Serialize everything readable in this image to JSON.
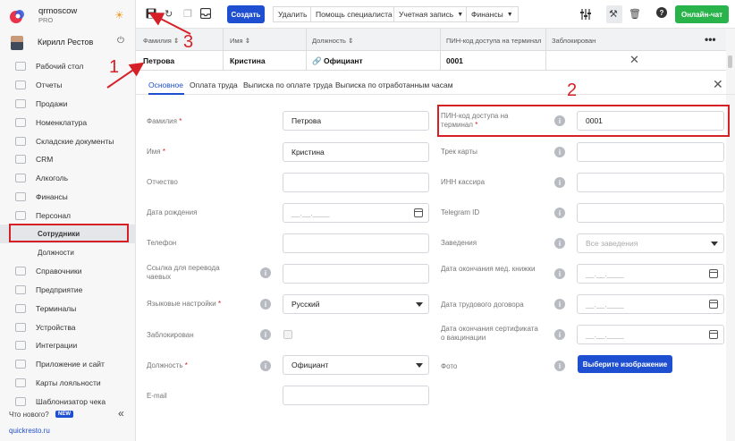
{
  "brand": {
    "name": "qrmoscow",
    "plan": "PRO"
  },
  "user": {
    "name": "Кирилл Рестов"
  },
  "sidebar": {
    "items": [
      {
        "label": "Рабочий стол"
      },
      {
        "label": "Отчеты"
      },
      {
        "label": "Продажи"
      },
      {
        "label": "Номенклатура"
      },
      {
        "label": "Складские документы"
      },
      {
        "label": "CRM"
      },
      {
        "label": "Алкоголь"
      },
      {
        "label": "Финансы"
      },
      {
        "label": "Персонал"
      }
    ],
    "sub_items": [
      {
        "label": "Сотрудники"
      },
      {
        "label": "Должности"
      }
    ],
    "items_after": [
      {
        "label": "Справочники"
      },
      {
        "label": "Предприятие"
      },
      {
        "label": "Терминалы"
      },
      {
        "label": "Устройства"
      },
      {
        "label": "Интеграции"
      },
      {
        "label": "Приложение и сайт"
      },
      {
        "label": "Карты лояльности"
      },
      {
        "label": "Шаблонизатор чека"
      }
    ],
    "whats_new": "Что нового?",
    "new_badge": "NEW",
    "site_link": "quickresto.ru"
  },
  "toolbar": {
    "create": "Создать",
    "delete": "Удалить",
    "help": "Помощь специалиста",
    "account": "Учетная запись",
    "finance": "Финансы",
    "online_chat": "Онлайн-чат"
  },
  "table": {
    "headers": [
      "Фамилия",
      "Имя",
      "Должность",
      "ПИН-код доступа на терминал",
      "Заблокирован"
    ],
    "row": {
      "last_name": "Петрова",
      "first_name": "Кристина",
      "position": "Официант",
      "pin": "0001"
    }
  },
  "tabs": [
    {
      "label": "Основное"
    },
    {
      "label": "Оплата труда"
    },
    {
      "label": "Выписка по оплате труда"
    },
    {
      "label": "Выписка по отработанным часам"
    }
  ],
  "form": {
    "last_name": {
      "label": "Фамилия",
      "value": "Петрова"
    },
    "first_name": {
      "label": "Имя",
      "value": "Кристина"
    },
    "middle_name": {
      "label": "Отчество",
      "value": ""
    },
    "birth_date": {
      "label": "Дата рождения",
      "placeholder": "__.__.____"
    },
    "phone": {
      "label": "Телефон",
      "value": ""
    },
    "tips_link": {
      "label": "Ссылка для перевода чаевых",
      "value": ""
    },
    "language": {
      "label": "Языковые настройки",
      "value": "Русский"
    },
    "blocked": {
      "label": "Заблокирован"
    },
    "position": {
      "label": "Должность",
      "value": "Официант"
    },
    "email": {
      "label": "E-mail",
      "value": ""
    },
    "pin": {
      "label": "ПИН-код доступа на терминал",
      "value": "0001"
    },
    "track": {
      "label": "Трек карты",
      "value": ""
    },
    "inn": {
      "label": "ИНН кассира",
      "value": ""
    },
    "telegram": {
      "label": "Telegram ID",
      "value": ""
    },
    "venues": {
      "label": "Заведения",
      "placeholder": "Все заведения"
    },
    "med_book": {
      "label": "Дата окончания мед. книжки",
      "placeholder": "__.__.____"
    },
    "contract": {
      "label": "Дата трудового договора",
      "placeholder": "__.__.____"
    },
    "vaccine": {
      "label": "Дата окончания сертификата о вакцинации",
      "placeholder": "__.__.____"
    },
    "photo": {
      "label": "Фото",
      "button": "Выберите изображение"
    }
  },
  "annotations": {
    "n1": "1",
    "n2": "2",
    "n3": "3"
  },
  "colors": {
    "accent": "#1f4fd1",
    "online": "#28b34b",
    "annotation": "#d62027"
  }
}
